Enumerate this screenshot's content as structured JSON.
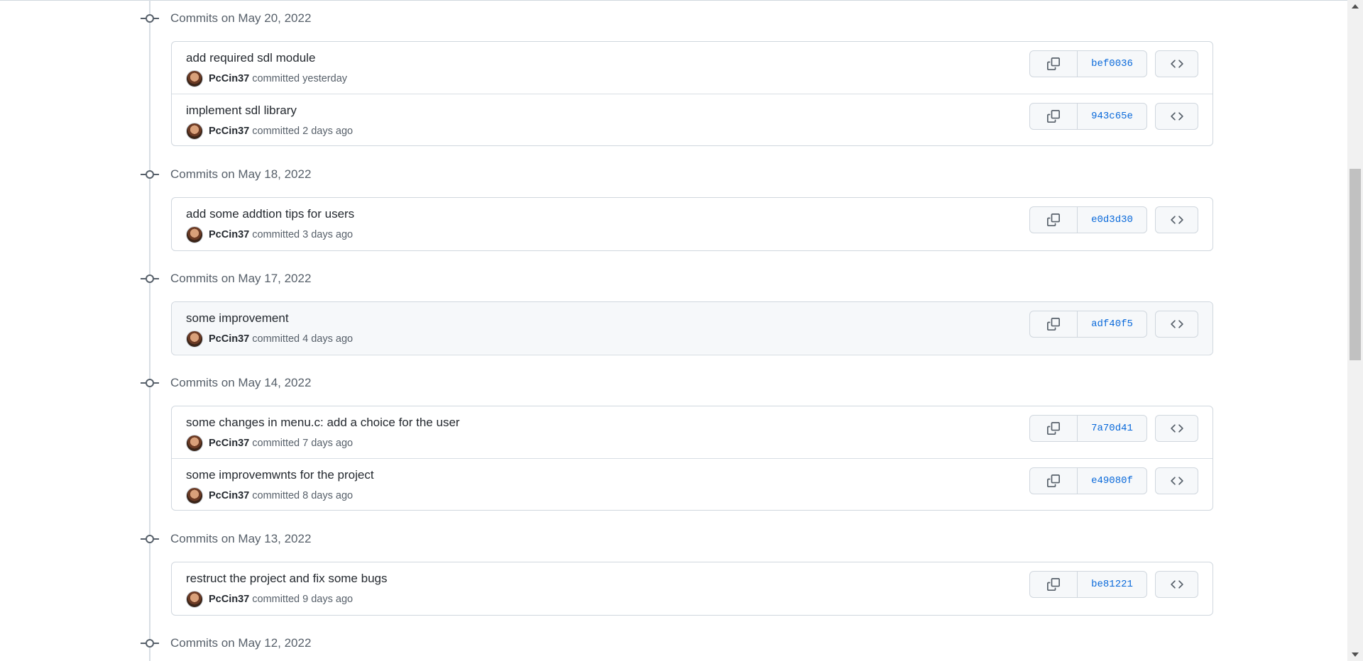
{
  "groups": [
    {
      "date": "Commits on May 20, 2022",
      "commits": [
        {
          "message": "add required sdl module",
          "author": "PcCin37",
          "time": "committed yesterday",
          "sha": "bef0036"
        },
        {
          "message": "implement sdl library",
          "author": "PcCin37",
          "time": "committed 2 days ago",
          "sha": "943c65e"
        }
      ]
    },
    {
      "date": "Commits on May 18, 2022",
      "commits": [
        {
          "message": "add some addtion tips for users",
          "author": "PcCin37",
          "time": "committed 3 days ago",
          "sha": "e0d3d30"
        }
      ]
    },
    {
      "date": "Commits on May 17, 2022",
      "commits": [
        {
          "message": "some improvement",
          "author": "PcCin37",
          "time": "committed 4 days ago",
          "sha": "adf40f5"
        }
      ]
    },
    {
      "date": "Commits on May 14, 2022",
      "commits": [
        {
          "message": "some changes in menu.c: add a choice for the user",
          "author": "PcCin37",
          "time": "committed 7 days ago",
          "sha": "7a70d41"
        },
        {
          "message": "some improvemwnts for the project",
          "author": "PcCin37",
          "time": "committed 8 days ago",
          "sha": "e49080f"
        }
      ]
    },
    {
      "date": "Commits on May 13, 2022",
      "commits": [
        {
          "message": "restruct the project and fix some bugs",
          "author": "PcCin37",
          "time": "committed 9 days ago",
          "sha": "be81221"
        }
      ]
    },
    {
      "date": "Commits on May 12, 2022",
      "commits": []
    }
  ],
  "icons": {
    "commit_node": "git-commit-icon",
    "copy": "copy-icon",
    "browse": "code-icon"
  },
  "colors": {
    "link": "#0969da",
    "muted": "#57606a",
    "border": "#d0d7de"
  }
}
